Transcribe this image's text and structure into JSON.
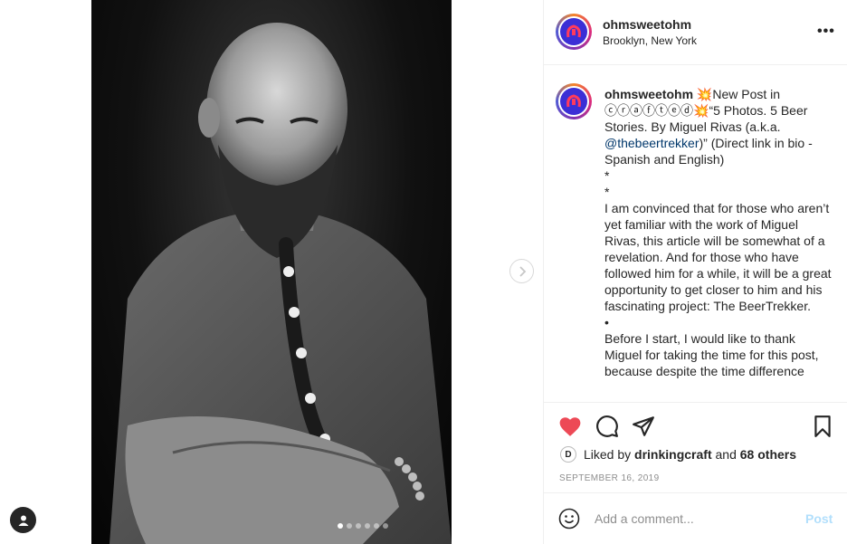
{
  "post": {
    "username": "ohmsweetohm",
    "location": "Brooklyn, New York"
  },
  "caption": {
    "username": "ohmsweetohm",
    "line1_emoji": "💥",
    "line1_text": "New Post in ⓒⓡⓐⓕⓣⓔⓓ",
    "line1_emoji2": "💥",
    "line1_rest": "“5 Photos. 5 Beer Stories. By Miguel Rivas (a.k.a. ",
    "mention": "@thebeertrekker",
    "line1_end": ")” (Direct link in bio - Spanish and English)",
    "star1": "*",
    "star2": "*",
    "para1": "I am convinced that for those who aren’t yet familiar with the work of Miguel Rivas, this article will be somewhat of a revelation. And for those who have followed him for a while, it will be a great opportunity to get closer to him and his fascinating project: The BeerTrekker.",
    "bullet": "•",
    "para2": "Before I start, I would like to thank Miguel for taking the time for this post, because despite the time difference"
  },
  "likes": {
    "prefix": "Liked by ",
    "user": "drinkingcraft",
    "mid": " and ",
    "count": "68 others"
  },
  "date": "SEPTEMBER 16, 2019",
  "comment_box": {
    "placeholder": "Add a comment...",
    "post_label": "Post"
  },
  "carousel": {
    "total": 6,
    "active_index": 0
  },
  "colors": {
    "like_red": "#ed4956",
    "link_blue": "#00376b",
    "post_disabled": "#b2dffc"
  }
}
